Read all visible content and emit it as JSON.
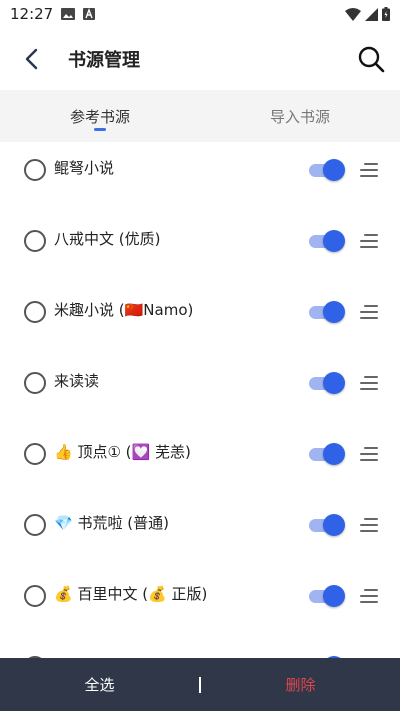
{
  "status": {
    "time": "12:27"
  },
  "header": {
    "title": "书源管理"
  },
  "tabs": [
    {
      "label": "参考书源"
    },
    {
      "label": "导入书源"
    }
  ],
  "sources": [
    {
      "label": "鲲弩小说",
      "enabled": true
    },
    {
      "label": "八戒中文 (优质)",
      "enabled": true
    },
    {
      "label": "米趣小说 (🇨🇳Namo)",
      "enabled": true
    },
    {
      "label": "来读读",
      "enabled": true
    },
    {
      "label": "👍 顶点① (💟 芜恙)",
      "enabled": true
    },
    {
      "label": "💎 书荒啦 (普通)",
      "enabled": true
    },
    {
      "label": "💰 百里中文 (💰 正版)",
      "enabled": true
    },
    {
      "label": "",
      "enabled": true
    }
  ],
  "footer": {
    "select_all": "全选",
    "delete": "删除"
  },
  "colors": {
    "accent": "#2f62e6",
    "bottom_bar": "#2f3748",
    "delete": "#e0454f"
  }
}
